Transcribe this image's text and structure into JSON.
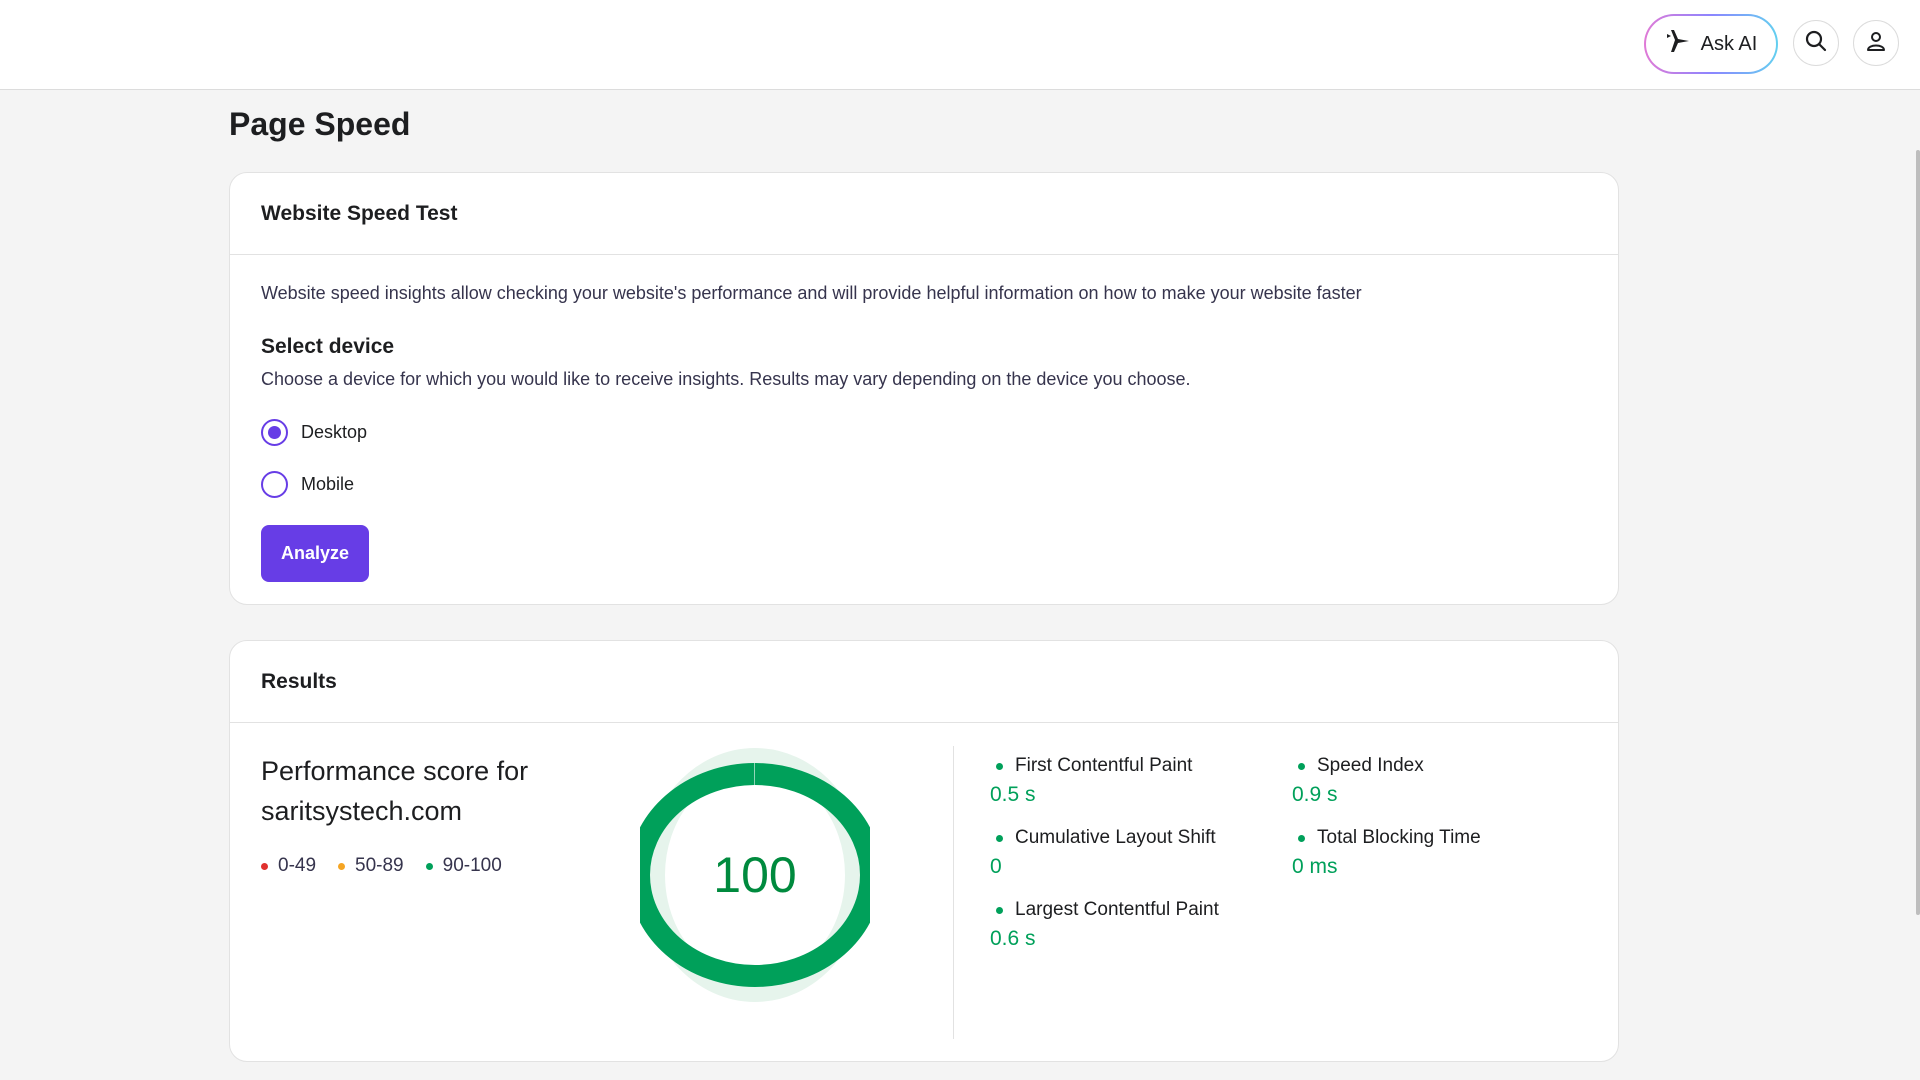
{
  "header": {
    "ask_ai_label": "Ask AI",
    "search_icon": "search-icon",
    "user_icon": "user-icon",
    "ask_ai_icon": "sparkle-icon"
  },
  "page": {
    "title": "Page Speed"
  },
  "speed_test": {
    "title": "Website Speed Test",
    "intro": "Website speed insights allow checking your website's performance and will provide helpful information on how to make your website faster",
    "select_title": "Select device",
    "select_desc": "Choose a device for which you would like to receive insights. Results may vary depending on the device you choose.",
    "options": [
      {
        "label": "Desktop",
        "selected": true
      },
      {
        "label": "Mobile",
        "selected": false
      }
    ],
    "analyze_label": "Analyze"
  },
  "results": {
    "title": "Results",
    "perf_title": "Performance score for saritsystech.com",
    "score": "100",
    "score_fraction": 1.0,
    "legend": [
      {
        "label": "0-49",
        "color": "#e0302e"
      },
      {
        "label": "50-89",
        "color": "#f5a524"
      },
      {
        "label": "90-100",
        "color": "#00a05a"
      }
    ],
    "metrics": [
      {
        "name": "First Contentful Paint",
        "value": "0.5 s"
      },
      {
        "name": "Speed Index",
        "value": "0.9 s"
      },
      {
        "name": "Cumulative Layout Shift",
        "value": "0"
      },
      {
        "name": "Total Blocking Time",
        "value": "0 ms"
      },
      {
        "name": "Largest Contentful Paint",
        "value": "0.6 s"
      }
    ]
  },
  "colors": {
    "accent": "#673de6",
    "good": "#00a05a"
  }
}
